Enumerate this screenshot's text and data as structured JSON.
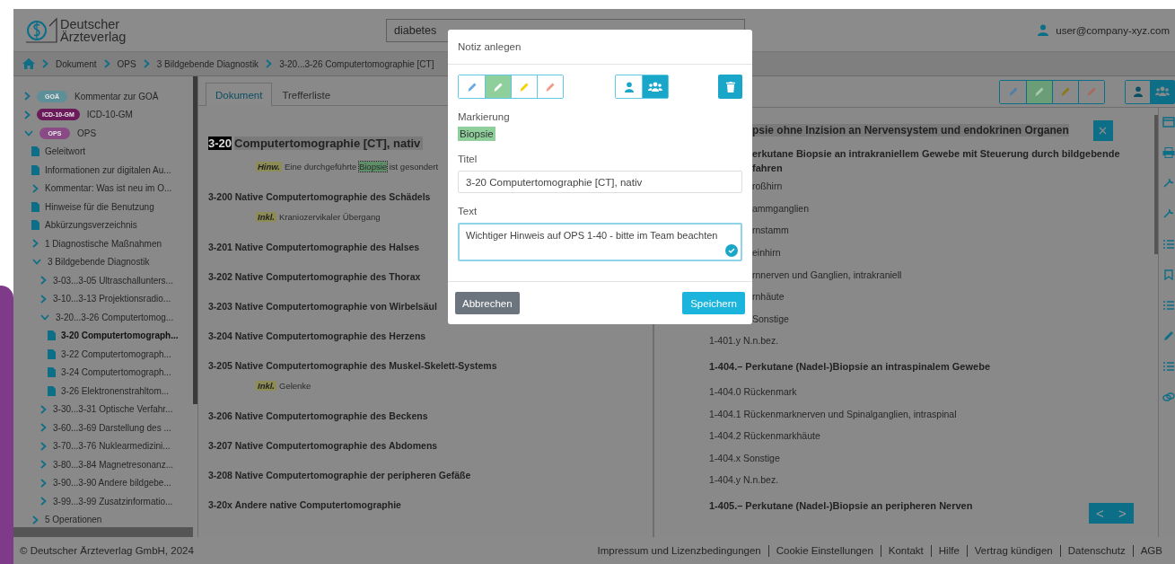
{
  "header": {
    "logo_line1": "Deutscher",
    "logo_line2": "Ärzteverlag",
    "search": {
      "value": "diabetes"
    },
    "user": "user@company-xyz.com"
  },
  "breadcrumb": [
    "Dokument",
    "OPS",
    "3 Bildgebende Diagnostik",
    "3-20...3-26 Computertomographie [CT]"
  ],
  "sidebar": {
    "tree": [
      {
        "kind": "folder",
        "badge": "GOÄ",
        "color": "#5d8f99",
        "label": "Kommentar zur GOÄ",
        "expanded": false,
        "selected": false
      },
      {
        "kind": "folder",
        "badge": "ICD-10-GM",
        "color": "#6b1a5a",
        "label": "ICD-10-GM",
        "expanded": false,
        "selected": false
      },
      {
        "kind": "folder",
        "badge": "OPS",
        "color": "#8a4a85",
        "label": "OPS",
        "expanded": true,
        "selected": false,
        "children": [
          {
            "kind": "doc",
            "label": "Geleitwort",
            "selected": false
          },
          {
            "kind": "doc",
            "label": "Informationen zur digitalen Au...",
            "selected": false
          },
          {
            "kind": "folder",
            "label": "Kommentar: Was ist neu im O...",
            "expanded": false,
            "selected": false
          },
          {
            "kind": "doc",
            "label": "Hinweise für die Benutzung",
            "selected": false
          },
          {
            "kind": "doc",
            "label": "Abkürzungsverzeichnis",
            "selected": false
          },
          {
            "kind": "folder",
            "label": "1 Diagnostische Maßnahmen",
            "expanded": false,
            "selected": false
          },
          {
            "kind": "folder",
            "label": "3 Bildgebende Diagnostik",
            "expanded": true,
            "selected": false,
            "children": [
              {
                "kind": "folder",
                "label": "3-03...3-05 Ultraschallunters...",
                "expanded": false,
                "selected": false
              },
              {
                "kind": "folder",
                "label": "3-10...3-13 Projektionsradio...",
                "expanded": false,
                "selected": false
              },
              {
                "kind": "folder",
                "label": "3-20...3-26 Computertomog...",
                "expanded": true,
                "selected": false,
                "children": [
                  {
                    "kind": "doc",
                    "label": "3-20 Computertomograph...",
                    "selected": true
                  },
                  {
                    "kind": "doc",
                    "label": "3-22 Computertomograph...",
                    "selected": false
                  },
                  {
                    "kind": "doc",
                    "label": "3-24 Computertomograph...",
                    "selected": false
                  },
                  {
                    "kind": "doc",
                    "label": "3-26 Elektronenstrahltom...",
                    "selected": false
                  }
                ]
              },
              {
                "kind": "folder",
                "label": "3-30...3-31 Optische Verfahr...",
                "expanded": false,
                "selected": false
              },
              {
                "kind": "folder",
                "label": "3-60...3-69 Darstellung des ...",
                "expanded": false,
                "selected": false
              },
              {
                "kind": "folder",
                "label": "3-70...3-76 Nuklearmedizini...",
                "expanded": false,
                "selected": false
              },
              {
                "kind": "folder",
                "label": "3-80...3-84 Magnetresonanz...",
                "expanded": false,
                "selected": false
              },
              {
                "kind": "folder",
                "label": "3-90...3-90 Andere bildgebe...",
                "expanded": false,
                "selected": false
              },
              {
                "kind": "folder",
                "label": "3-99...3-99 Zusatzinformatio...",
                "expanded": false,
                "selected": false
              }
            ]
          },
          {
            "kind": "folder",
            "label": "5 Operationen",
            "expanded": false,
            "selected": false
          }
        ]
      }
    ]
  },
  "document": {
    "tabs": [
      {
        "label": "Dokument",
        "selected": true
      },
      {
        "label": "Trefferliste",
        "selected": false
      }
    ],
    "blocks": [
      {
        "kind": "heading",
        "code": "3-20",
        "text": "Computertomographie [CT], nativ"
      },
      {
        "kind": "note",
        "label": "Hinw.",
        "text": "Eine durchgeführte ",
        "mark": "Biopsie",
        "rest": " ist gesondert"
      },
      {
        "kind": "entry",
        "text": "3-200 Native Computertomographie des Schädels"
      },
      {
        "kind": "note",
        "label": "Inkl.",
        "text": "Kraniozervikaler Übergang"
      },
      {
        "kind": "entry",
        "text": "3-201 Native Computertomographie des Halses"
      },
      {
        "kind": "entry",
        "text": "3-202 Native Computertomographie des Thorax"
      },
      {
        "kind": "entry",
        "text": "3-203 Native Computertomographie von Wirbelsäul"
      },
      {
        "kind": "entry",
        "text": "3-204 Native Computertomographie des Herzens"
      },
      {
        "kind": "entry",
        "text": "3-205 Native Computertomographie des Muskel-Skelett-Systems"
      },
      {
        "kind": "note",
        "label": "Inkl.",
        "text": "Gelenke"
      },
      {
        "kind": "entry",
        "text": "3-206 Native Computertomographie des Beckens"
      },
      {
        "kind": "entry",
        "text": "3-207 Native Computertomographie des Abdomens"
      },
      {
        "kind": "entry",
        "text": "3-208 Native Computertomographie der peripheren Gefäße"
      },
      {
        "kind": "entry",
        "text": "3-20x Andere native Computertomographie"
      }
    ]
  },
  "reference": {
    "highlighters": [
      {
        "color": "#4f7fa8",
        "selected": false
      },
      {
        "color": "#6b9e77",
        "selected": true
      },
      {
        "color": "#8c7a1a",
        "selected": false
      },
      {
        "color": "#a86a5c",
        "selected": false
      }
    ],
    "visibility": [
      {
        "kind": "private",
        "selected": false
      },
      {
        "kind": "shared",
        "selected": true
      }
    ],
    "heading": "psie ohne Inzision an Nervensystem und endokrinen Organen",
    "partial_lines": [
      {
        "kind": "bold",
        "text": "erkutane Biopsie an intrakraniellem Gewebe mit Steuerung durch bildgebende"
      },
      {
        "kind": "bold",
        "text": "fahren"
      },
      {
        "kind": "plain",
        "text": "roßhirn"
      },
      {
        "kind": "plain",
        "text": "ammganglien"
      },
      {
        "kind": "plain",
        "text": "rnstamm"
      },
      {
        "kind": "plain",
        "text": "einhirn"
      },
      {
        "kind": "plain",
        "text": "rnnerven und Ganglien, intrakraniell"
      },
      {
        "kind": "plain",
        "text": "rnhäute"
      },
      {
        "kind": "plain",
        "text": "Sonstige"
      }
    ],
    "lines": [
      {
        "kind": "plain",
        "text": "1-401.y N.n.bez."
      },
      {
        "kind": "bold",
        "text": "1-404.– Perkutane (Nadel-)Biopsie an intraspinalem Gewebe"
      },
      {
        "kind": "plain",
        "text": "1-404.0 Rückenmark"
      },
      {
        "kind": "plain",
        "text": "1-404.1 Rückenmarknerven und Spinalganglien, intraspinal"
      },
      {
        "kind": "plain",
        "text": "1-404.2 Rückenmarkhäute"
      },
      {
        "kind": "plain",
        "text": "1-404.x Sonstige"
      },
      {
        "kind": "plain",
        "text": "1-404.y N.n.bez."
      },
      {
        "kind": "bold",
        "text": "1-405.– Perkutane (Nadel-)Biopsie an peripheren Nerven"
      }
    ],
    "pager": {
      "prev": "<",
      "next": ">"
    }
  },
  "dialog": {
    "title": "Notiz anlegen",
    "colors": [
      {
        "color": "#6aa8e0",
        "selected": false
      },
      {
        "color": "#8fcf9c",
        "selected": true
      },
      {
        "color": "#f2d200",
        "selected": false
      },
      {
        "color": "#f29a88",
        "selected": false
      }
    ],
    "visibility": [
      {
        "kind": "private",
        "selected": false
      },
      {
        "kind": "shared",
        "selected": true
      }
    ],
    "marking_label": "Markierung",
    "marking": "Biopsie",
    "title_label": "Titel",
    "title_value": "3-20 Computertomographie [CT], nativ",
    "text_label": "Text",
    "text_value": "Wichtiger Hinweis auf OPS 1-40 - bitte im Team beachten",
    "cancel": "Abbrechen",
    "save": "Speichern"
  },
  "footer": {
    "copyright": "© Deutscher Ärzteverlag GmbH, 2024",
    "links": [
      "Impressum und Lizenzbedingungen",
      "Cookie Einstellungen",
      "Kontakt",
      "Hilfe",
      "Vertrag kündigen",
      "Datenschutz",
      "AGB"
    ]
  }
}
